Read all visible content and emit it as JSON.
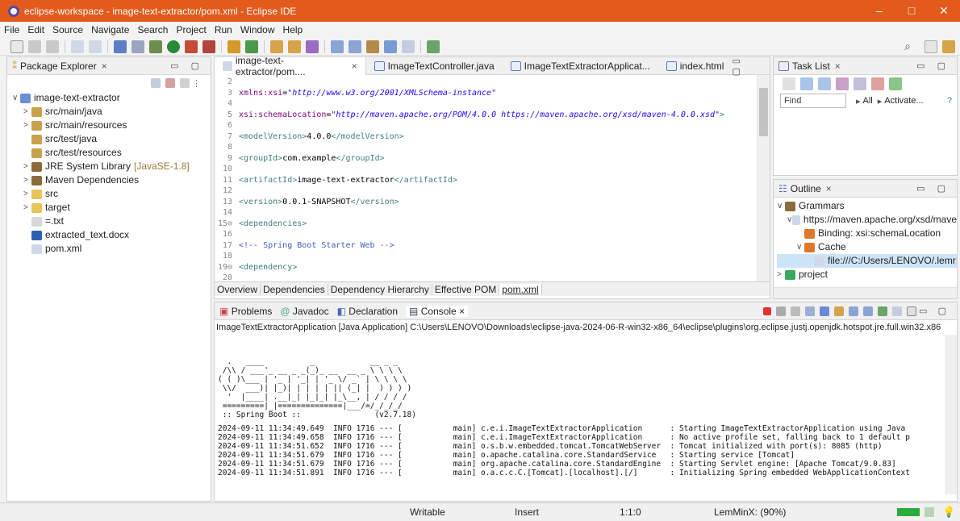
{
  "window": {
    "title": "eclipse-workspace - image-text-extractor/pom.xml - Eclipse IDE",
    "minimize": "–",
    "maximize": "□",
    "close": "✕"
  },
  "menu": [
    "File",
    "Edit",
    "Source",
    "Navigate",
    "Search",
    "Project",
    "Run",
    "Window",
    "Help"
  ],
  "package_explorer": {
    "tab": "Package Explorer",
    "close": "×",
    "items": [
      {
        "label": "image-text-extractor",
        "arrow": "∨",
        "icon_color": "#6a8fd6",
        "indent": 0
      },
      {
        "label": "src/main/java",
        "arrow": ">",
        "icon_color": "#c8a24a",
        "indent": 1
      },
      {
        "label": "src/main/resources",
        "arrow": ">",
        "icon_color": "#c8a24a",
        "indent": 1
      },
      {
        "label": "src/test/java",
        "arrow": "",
        "icon_color": "#c8a24a",
        "indent": 1
      },
      {
        "label": "src/test/resources",
        "arrow": "",
        "icon_color": "#c8a24a",
        "indent": 1
      },
      {
        "label": "JRE System Library",
        "suffix": "[JavaSE-1.8]",
        "arrow": ">",
        "icon_color": "#8a6c3a",
        "indent": 1
      },
      {
        "label": "Maven Dependencies",
        "arrow": ">",
        "icon_color": "#8a6c3a",
        "indent": 1
      },
      {
        "label": "src",
        "arrow": ">",
        "icon_color": "#e8c45a",
        "indent": 1
      },
      {
        "label": "target",
        "arrow": ">",
        "icon_color": "#e8c45a",
        "indent": 1
      },
      {
        "label": "=.txt",
        "arrow": "",
        "icon_color": "#d8d8d8",
        "indent": 1
      },
      {
        "label": "extracted_text.docx",
        "arrow": "",
        "icon_color": "#2b5fb4",
        "indent": 1
      },
      {
        "label": "pom.xml",
        "arrow": "",
        "icon_color": "#cfd8ea",
        "indent": 1
      }
    ]
  },
  "editor": {
    "tabs": [
      "image-text-extractor/pom....",
      "ImageTextController.java",
      "ImageTextExtractorApplicat...",
      "index.html"
    ],
    "tab_close": "×",
    "lines": [
      {
        "n": "2",
        "parts": []
      },
      {
        "n": "3",
        "parts": [
          {
            "c": "attr",
            "t": "xmlns:xsi"
          },
          {
            "c": "txt",
            "t": "="
          },
          {
            "c": "val",
            "t": "\"http://www.w3.org/2001/XMLSchema-instance\""
          }
        ]
      },
      {
        "n": "4",
        "parts": []
      },
      {
        "n": "5",
        "parts": [
          {
            "c": "attr",
            "t": "xsi:schemaLocation"
          },
          {
            "c": "txt",
            "t": "="
          },
          {
            "c": "val",
            "t": "\"http://maven.apache.org/POM/4.0.0 https://maven.apache.org/xsd/maven-4.0.0.xsd\""
          },
          {
            "c": "tag",
            "t": ">"
          }
        ]
      },
      {
        "n": "6",
        "parts": []
      },
      {
        "n": "7",
        "parts": [
          {
            "c": "tag",
            "t": "<modelVersion>"
          },
          {
            "c": "txt",
            "t": "4.0.0"
          },
          {
            "c": "tag",
            "t": "</modelVersion>"
          }
        ]
      },
      {
        "n": "8",
        "parts": []
      },
      {
        "n": "9",
        "parts": [
          {
            "c": "tag",
            "t": "<groupId>"
          },
          {
            "c": "txt",
            "t": "com.example"
          },
          {
            "c": "tag",
            "t": "</groupId>"
          }
        ]
      },
      {
        "n": "10",
        "parts": []
      },
      {
        "n": "11",
        "parts": [
          {
            "c": "tag",
            "t": "<artifactId>"
          },
          {
            "c": "txt",
            "t": "image-text-extractor"
          },
          {
            "c": "tag",
            "t": "</artifactId>"
          }
        ]
      },
      {
        "n": "12",
        "parts": []
      },
      {
        "n": "13",
        "parts": [
          {
            "c": "tag",
            "t": "<version>"
          },
          {
            "c": "txt",
            "t": "0.0.1-SNAPSHOT"
          },
          {
            "c": "tag",
            "t": "</version>"
          }
        ]
      },
      {
        "n": "14",
        "parts": []
      },
      {
        "n": "15⊖",
        "parts": [
          {
            "c": "tag",
            "t": "<dependencies>"
          }
        ]
      },
      {
        "n": "16",
        "parts": []
      },
      {
        "n": "17",
        "parts": [
          {
            "c": "cmt",
            "t": "<!-- Spring Boot Starter Web -->"
          }
        ]
      },
      {
        "n": "18",
        "parts": []
      },
      {
        "n": "19⊖",
        "parts": [
          {
            "c": "tag",
            "t": "<dependency>"
          }
        ]
      },
      {
        "n": "20",
        "parts": []
      }
    ],
    "bottom_tabs": [
      "Overview",
      "Dependencies",
      "Dependency Hierarchy",
      "Effective POM",
      "pom.xml"
    ]
  },
  "task_list": {
    "tab": "Task List",
    "find_placeholder": "Find",
    "all": "All",
    "activate": "Activate...",
    "help": "?"
  },
  "outline": {
    "tab": "Outline",
    "items": [
      {
        "label": "Grammars",
        "arrow": "∨",
        "indent": 0,
        "icon_color": "#8a6c3a"
      },
      {
        "label": "https://maven.apache.org/xsd/mave",
        "arrow": "∨",
        "indent": 1,
        "icon_color": "#cfd8ea"
      },
      {
        "label": "Binding: xsi:schemaLocation",
        "arrow": "",
        "indent": 2,
        "icon_color": "#e0782a"
      },
      {
        "label": "Cache",
        "arrow": "∨",
        "indent": 2,
        "icon_color": "#e0782a"
      },
      {
        "label": "file:///C:/Users/LENOVO/.lemr",
        "arrow": "",
        "indent": 3,
        "icon_color": "#cfd8ea",
        "selected": true
      },
      {
        "label": "project",
        "arrow": ">",
        "indent": 0,
        "icon_color": "#3aa85a"
      }
    ]
  },
  "console": {
    "tabs": [
      "Problems",
      "Javadoc",
      "Declaration",
      "Console"
    ],
    "header": "ImageTextExtractorApplication [Java Application] C:\\Users\\LENOVO\\Downloads\\eclipse-java-2024-06-R-win32-x86_64\\eclipse\\plugins\\org.eclipse.justj.openjdk.hotspot.jre.full.win32.x86",
    "banner": "  .   ____          _            __ _ _\n /\\\\ / ___'_ __ _ _(_)_ __  __ _ \\ \\ \\ \\\n( ( )\\___ | '_ | '_| | '_ \\/ _` | \\ \\ \\ \\\n \\\\/  ___)| |_)| | | | | || (_| |  ) ) ) )\n  '  |____| .__|_| |_|_| |_\\__, | / / / /\n =========|_|==============|___/=/_/_/_/\n :: Spring Boot ::                (v2.7.18)",
    "logs": [
      "2024-09-11 11:34:49.649  INFO 1716 --- [           main] c.e.i.ImageTextExtractorApplication      : Starting ImageTextExtractorApplication using Java",
      "2024-09-11 11:34:49.658  INFO 1716 --- [           main] c.e.i.ImageTextExtractorApplication      : No active profile set, falling back to 1 default p",
      "2024-09-11 11:34:51.652  INFO 1716 --- [           main] o.s.b.w.embedded.tomcat.TomcatWebServer  : Tomcat initialized with port(s): 8085 (http)",
      "2024-09-11 11:34:51.679  INFO 1716 --- [           main] o.apache.catalina.core.StandardService   : Starting service [Tomcat]",
      "2024-09-11 11:34:51.679  INFO 1716 --- [           main] org.apache.catalina.core.StandardEngine  : Starting Servlet engine: [Apache Tomcat/9.0.83]",
      "2024-09-11 11:34:51.891  INFO 1716 --- [           main] o.a.c.c.C.[Tomcat].[localhost].[/]       : Initializing Spring embedded WebApplicationContext"
    ]
  },
  "status": {
    "writable": "Writable",
    "insert": "Insert",
    "position": "1:1:0",
    "lemminx": "LemMinX: (90%)"
  },
  "colors": {
    "titlebar": "#e25a1c",
    "selection": "#cde3f7"
  }
}
